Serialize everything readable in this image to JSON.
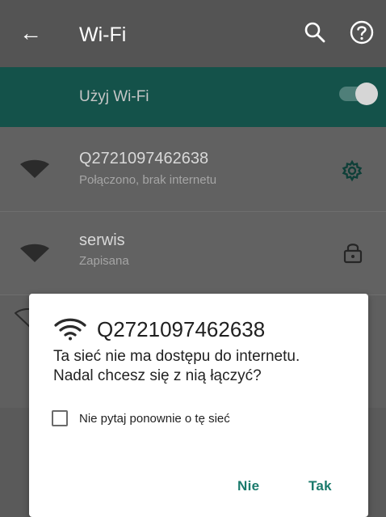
{
  "app_bar": {
    "title": "Wi-Fi",
    "back_icon": "arrow-left-icon",
    "search_icon": "search-icon",
    "help_icon": "help-circle-icon"
  },
  "use_wifi": {
    "label": "Użyj Wi-Fi",
    "enabled": true
  },
  "networks": [
    {
      "ssid": "Q2721097462638",
      "status": "Połączono, brak internetu",
      "icon": "wifi-full-icon",
      "action_icon": "gear-icon"
    },
    {
      "ssid": "serwis",
      "status": "Zapisana",
      "icon": "wifi-full-icon",
      "action_icon": "lock-icon"
    }
  ],
  "dialog": {
    "icon": "wifi-icon",
    "title": "Q2721097462638",
    "message": "Ta sieć nie ma dostępu do internetu.\nNadal chcesz się z nią łączyć?",
    "checkbox_label": "Nie pytaj ponownie o tę sieć",
    "checkbox_checked": false,
    "buttons": {
      "negative": "Nie",
      "positive": "Tak"
    }
  },
  "colors": {
    "dialog_accent": "#1a7a6c",
    "app_bar_dim": "#545454",
    "use_wifi_bar_dim": "#14524a"
  }
}
